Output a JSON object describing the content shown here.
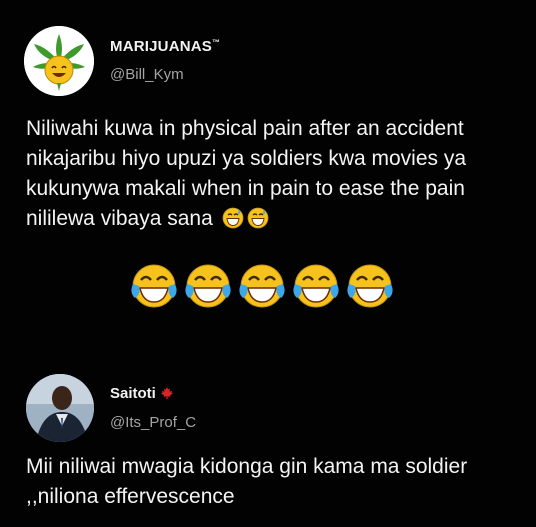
{
  "tweets": [
    {
      "display_name": "MARIJUANAS",
      "name_suffix": "™",
      "handle": "@Bill_Kym",
      "avatar_icon": "cannabis-leaf-smiley-icon",
      "text": "Niliwahi kuwa in physical pain after an accident nikajaribu hiyo upuzi ya soldiers kwa movies ya kukunywa makali when in pain to ease the pain nililewa vibaya sana",
      "inline_emojis": [
        "grinning-sweat-emoji",
        "grinning-sweat-emoji"
      ],
      "reaction_emojis": [
        "tears-of-joy-emoji",
        "tears-of-joy-emoji",
        "tears-of-joy-emoji",
        "tears-of-joy-emoji",
        "tears-of-joy-emoji"
      ]
    },
    {
      "display_name": "Saitoti",
      "name_suffix_icon": "maple-leaf-icon",
      "handle": "@Its_Prof_C",
      "avatar_icon": "user-photo-avatar",
      "text": "Mii niliwai mwagia kidonga gin kama ma soldier ,,niliona effervescence"
    }
  ],
  "colors": {
    "background": "#020202",
    "text": "#f4f4f4",
    "handle": "#a4a4a4",
    "maple_leaf": "#d8232a",
    "emoji_yellow": "#f7c21b",
    "tear_blue": "#3ea7e8"
  }
}
